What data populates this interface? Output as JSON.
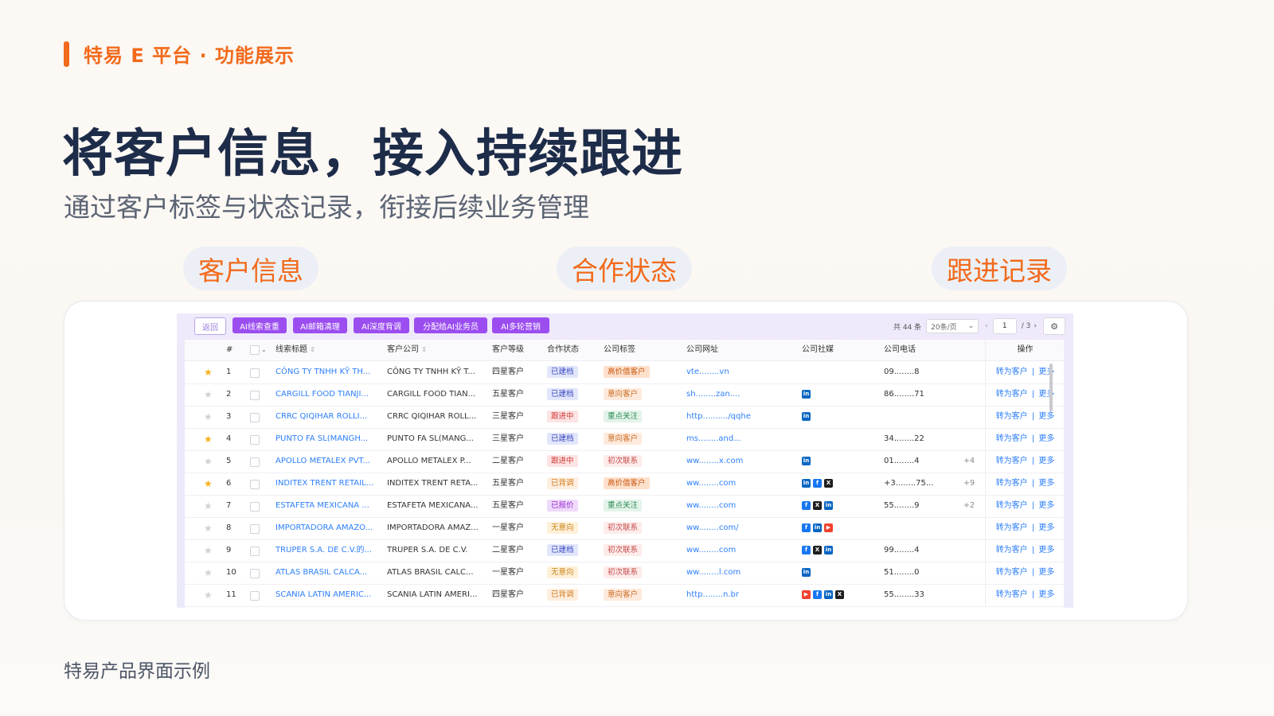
{
  "brand": {
    "title": "特易 E 平台 · 功能展示",
    "accent_color": "#f26a1b"
  },
  "headline": "将客户信息，接入持续跟进",
  "subheadline": "通过客户标签与状态记录，衔接后续业务管理",
  "pills": [
    "客户信息",
    "合作状态",
    "跟进记录"
  ],
  "footer": "特易产品界面示例",
  "toolbar": {
    "back": "返回",
    "buttons": [
      "AI线索查重",
      "AI邮箱清理",
      "AI深度背调",
      "分配给AI业务员",
      "AI多轮营销"
    ],
    "total": "共 44 条",
    "page_size": "20条/页",
    "current_page": "1",
    "total_pages": "/ 3",
    "prev_icon": "chevron-left-icon",
    "next_icon": "chevron-right-icon",
    "settings_icon": "gear-icon"
  },
  "table": {
    "headers": {
      "index": "#",
      "title": "线索标题",
      "company": "客户公司",
      "level": "客户等级",
      "status": "合作状态",
      "label": "公司标签",
      "website": "公司网址",
      "social": "公司社媒",
      "phone": "公司电话",
      "ops": "操作"
    },
    "ops": {
      "convert": "转为客户",
      "sep": "|",
      "more": "更多"
    },
    "rows": [
      {
        "starred": true,
        "index": "1",
        "title": "CÔNG TY TNHH KỸ TH...",
        "company": "CÔNG TY TNHH KỸ T...",
        "level": "四星客户",
        "status": "已建档",
        "status_type": "build",
        "label": "高价值客户",
        "label_type": "high",
        "website": "vte........vn",
        "social": [],
        "phone": "09........8",
        "extra": ""
      },
      {
        "starred": false,
        "index": "2",
        "title": "CARGILL FOOD TIANJI...",
        "company": "CARGILL FOOD TIAN...",
        "level": "五星客户",
        "status": "已建档",
        "status_type": "build",
        "label": "意向客户",
        "label_type": "intent",
        "website": "sh........zan....",
        "social": [
          "in"
        ],
        "phone": "86........71",
        "extra": ""
      },
      {
        "starred": false,
        "index": "3",
        "title": "CRRC QIQIHAR ROLLI...",
        "company": "CRRC QIQIHAR ROLL...",
        "level": "三星客户",
        "status": "跟进中",
        "status_type": "follow",
        "label": "重点关注",
        "label_type": "key",
        "website": "http........../qqhe",
        "social": [
          "in"
        ],
        "phone": "",
        "extra": ""
      },
      {
        "starred": true,
        "index": "4",
        "title": "PUNTO FA SL(MANGH...",
        "company": "PUNTO FA SL(MANG...",
        "level": "三星客户",
        "status": "已建档",
        "status_type": "build",
        "label": "意向客户",
        "label_type": "intent",
        "website": "ms........and...",
        "social": [],
        "phone": "34........22",
        "extra": ""
      },
      {
        "starred": false,
        "index": "5",
        "title": "APOLLO METALEX PVT...",
        "company": "APOLLO METALEX P...",
        "level": "二星客户",
        "status": "跟进中",
        "status_type": "follow",
        "label": "初次联系",
        "label_type": "first",
        "website": "ww........x.com",
        "social": [
          "in"
        ],
        "phone": "01........4",
        "extra": "+4"
      },
      {
        "starred": true,
        "index": "6",
        "title": "INDITEX TRENT RETAIL...",
        "company": "INDITEX TRENT RETA...",
        "level": "五星客户",
        "status": "已背调",
        "status_type": "back",
        "label": "高价值客户",
        "label_type": "high",
        "website": "ww........com",
        "social": [
          "in",
          "fb",
          "x"
        ],
        "phone": "+3........75...",
        "extra": "+9"
      },
      {
        "starred": false,
        "index": "7",
        "title": "ESTAFETA MEXICANA ...",
        "company": "ESTAFETA MEXICANA...",
        "level": "五星客户",
        "status": "已报价",
        "status_type": "quote",
        "label": "重点关注",
        "label_type": "key",
        "website": "ww........com",
        "social": [
          "fb",
          "x",
          "in"
        ],
        "phone": "55........9",
        "extra": "+2"
      },
      {
        "starred": false,
        "index": "8",
        "title": "IMPORTADORA AMAZO...",
        "company": "IMPORTADORA AMAZ...",
        "level": "一星客户",
        "status": "无意向",
        "status_type": "none",
        "label": "初次联系",
        "label_type": "first",
        "website": "ww........com/",
        "social": [
          "fb",
          "in",
          "yt"
        ],
        "phone": "",
        "extra": ""
      },
      {
        "starred": false,
        "index": "9",
        "title": "TRUPER S.A. DE C.V.的...",
        "company": "TRUPER S.A. DE C.V.",
        "level": "二星客户",
        "status": "已建档",
        "status_type": "build",
        "label": "初次联系",
        "label_type": "first",
        "website": "ww........com",
        "social": [
          "fb",
          "x",
          "in"
        ],
        "phone": "99........4",
        "extra": ""
      },
      {
        "starred": false,
        "index": "10",
        "title": "ATLAS BRASIL CALCA...",
        "company": "ATLAS BRASIL CALC...",
        "level": "一星客户",
        "status": "无意向",
        "status_type": "none",
        "label": "初次联系",
        "label_type": "first",
        "website": "ww........l.com",
        "social": [
          "in"
        ],
        "phone": "51........0",
        "extra": ""
      },
      {
        "starred": false,
        "index": "11",
        "title": "SCANIA LATIN AMERIC...",
        "company": "SCANIA LATIN AMERI...",
        "level": "四星客户",
        "status": "已背调",
        "status_type": "back",
        "label": "意向客户",
        "label_type": "intent",
        "website": "http........n.br",
        "social": [
          "yt",
          "fb",
          "in",
          "x"
        ],
        "phone": "55........33",
        "extra": ""
      }
    ]
  }
}
